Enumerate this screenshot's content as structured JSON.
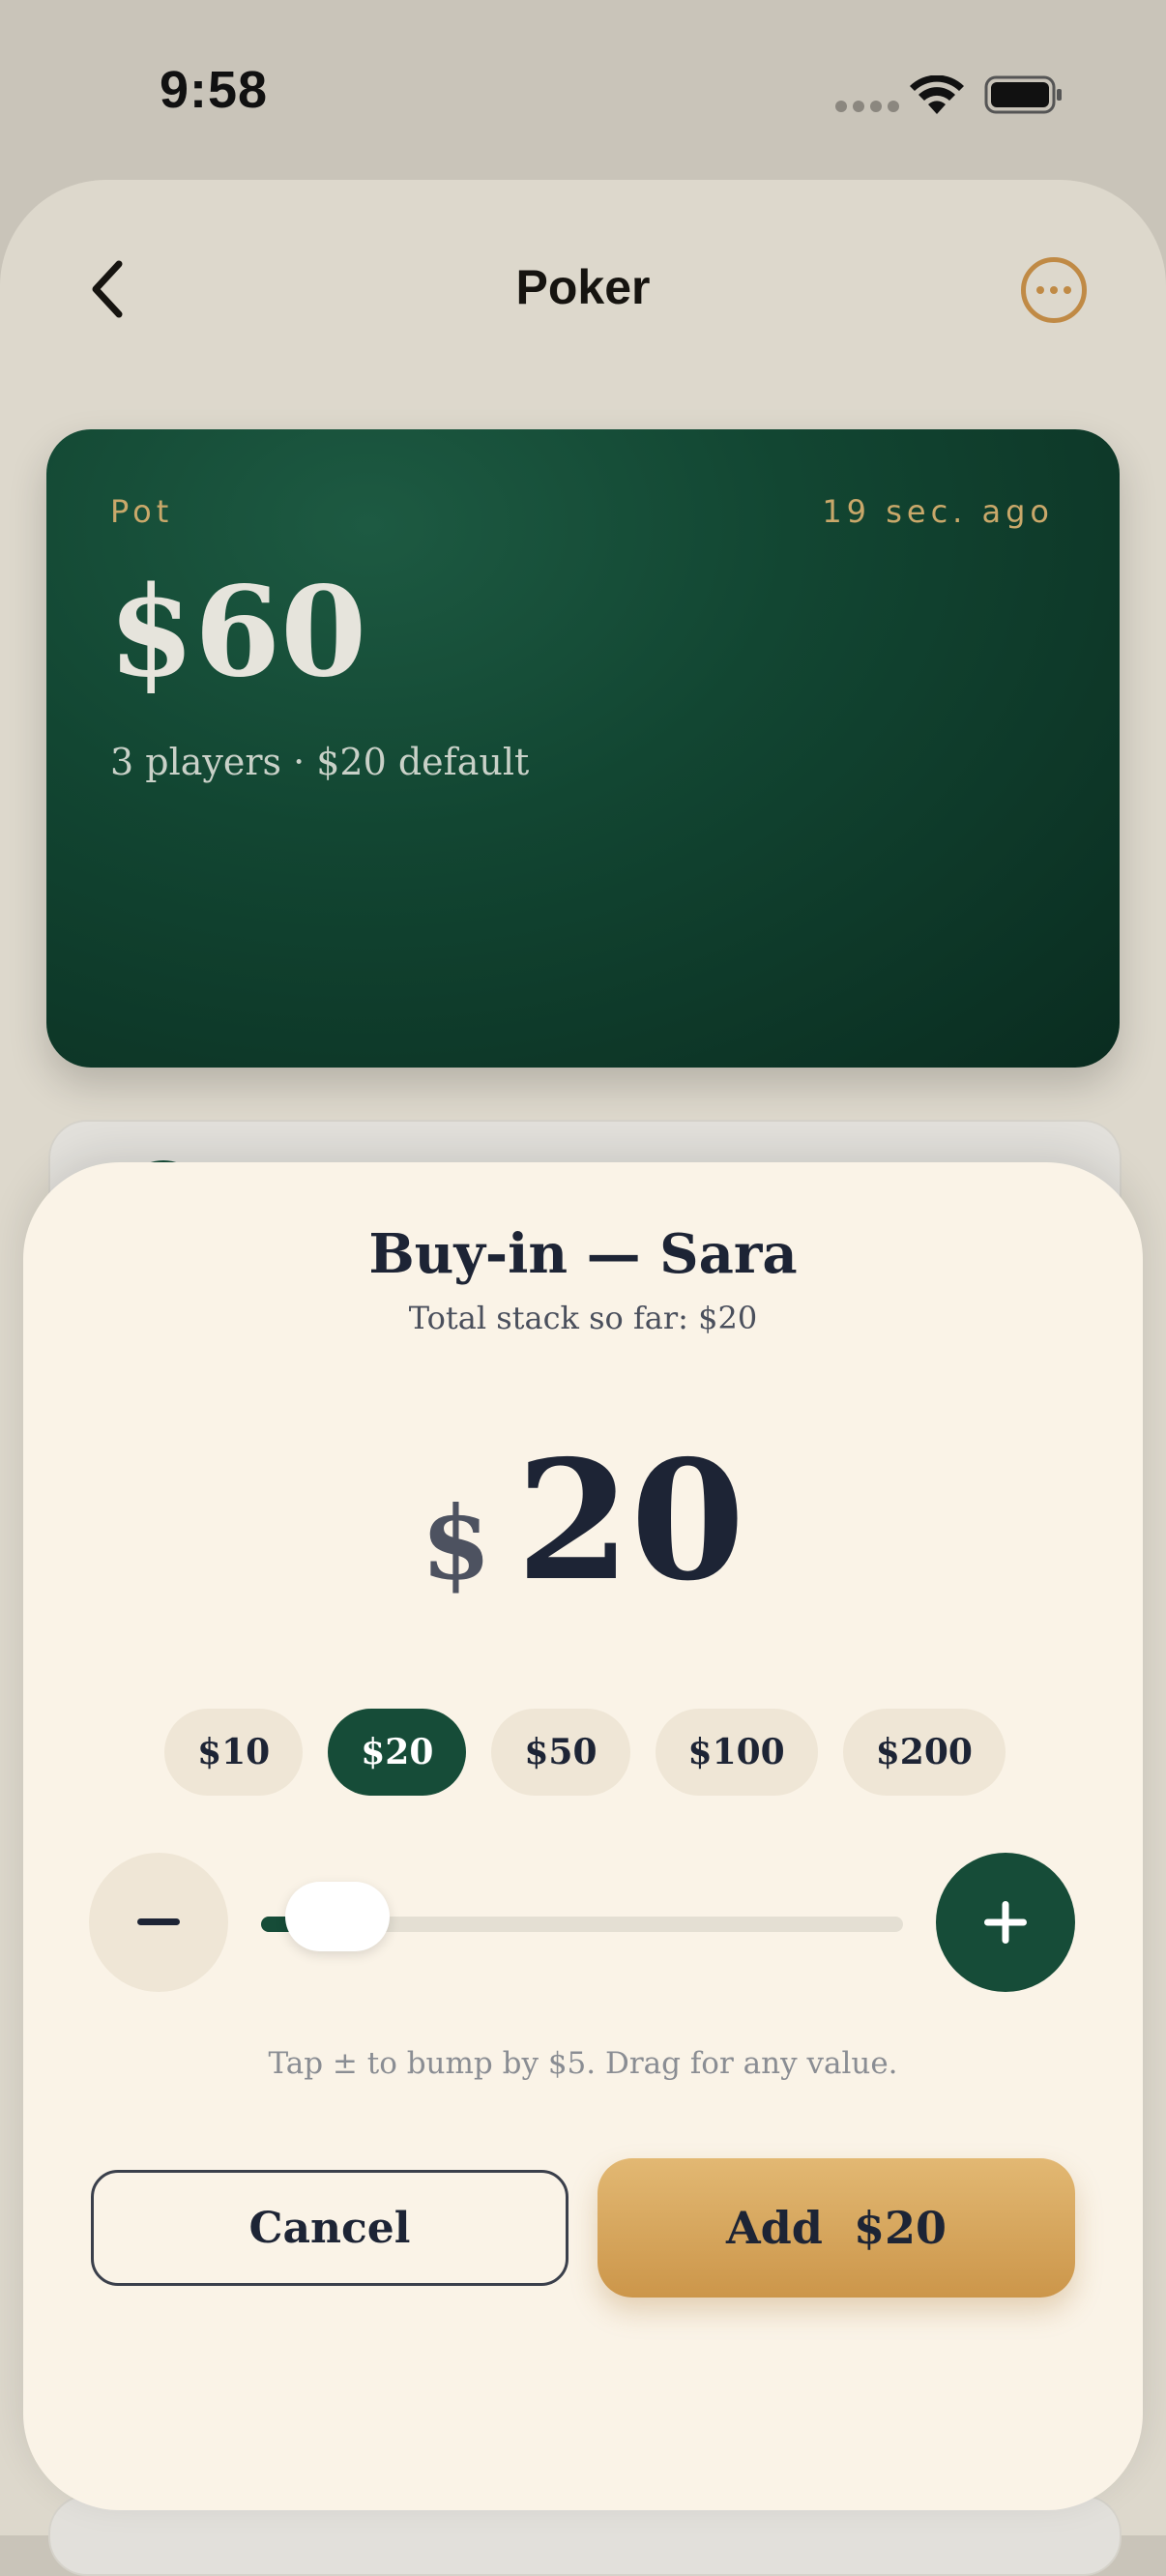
{
  "status_bar": {
    "time": "9:58"
  },
  "nav": {
    "title": "Poker"
  },
  "pot": {
    "label": "Pot",
    "updated": "19 sec. ago",
    "amount": "$60",
    "summary": "3 players  ·  $20 default"
  },
  "modal": {
    "title": "Buy-in — Sara",
    "subtitle": "Total stack so far: $20",
    "currency_symbol": "$",
    "amount": "20",
    "chips": [
      {
        "label": "$10",
        "selected": false
      },
      {
        "label": "$20",
        "selected": true
      },
      {
        "label": "$50",
        "selected": false
      },
      {
        "label": "$100",
        "selected": false
      },
      {
        "label": "$200",
        "selected": false
      }
    ],
    "slider_fraction": 0.06,
    "hint": "Tap ± to bump by $5.  Drag for any value.",
    "cancel_label": "Cancel",
    "add_label": "Add  $20"
  },
  "colors": {
    "accent_green": "#164c38",
    "accent_gold": "#c08a45",
    "sheet_bg": "#faf3e7"
  }
}
